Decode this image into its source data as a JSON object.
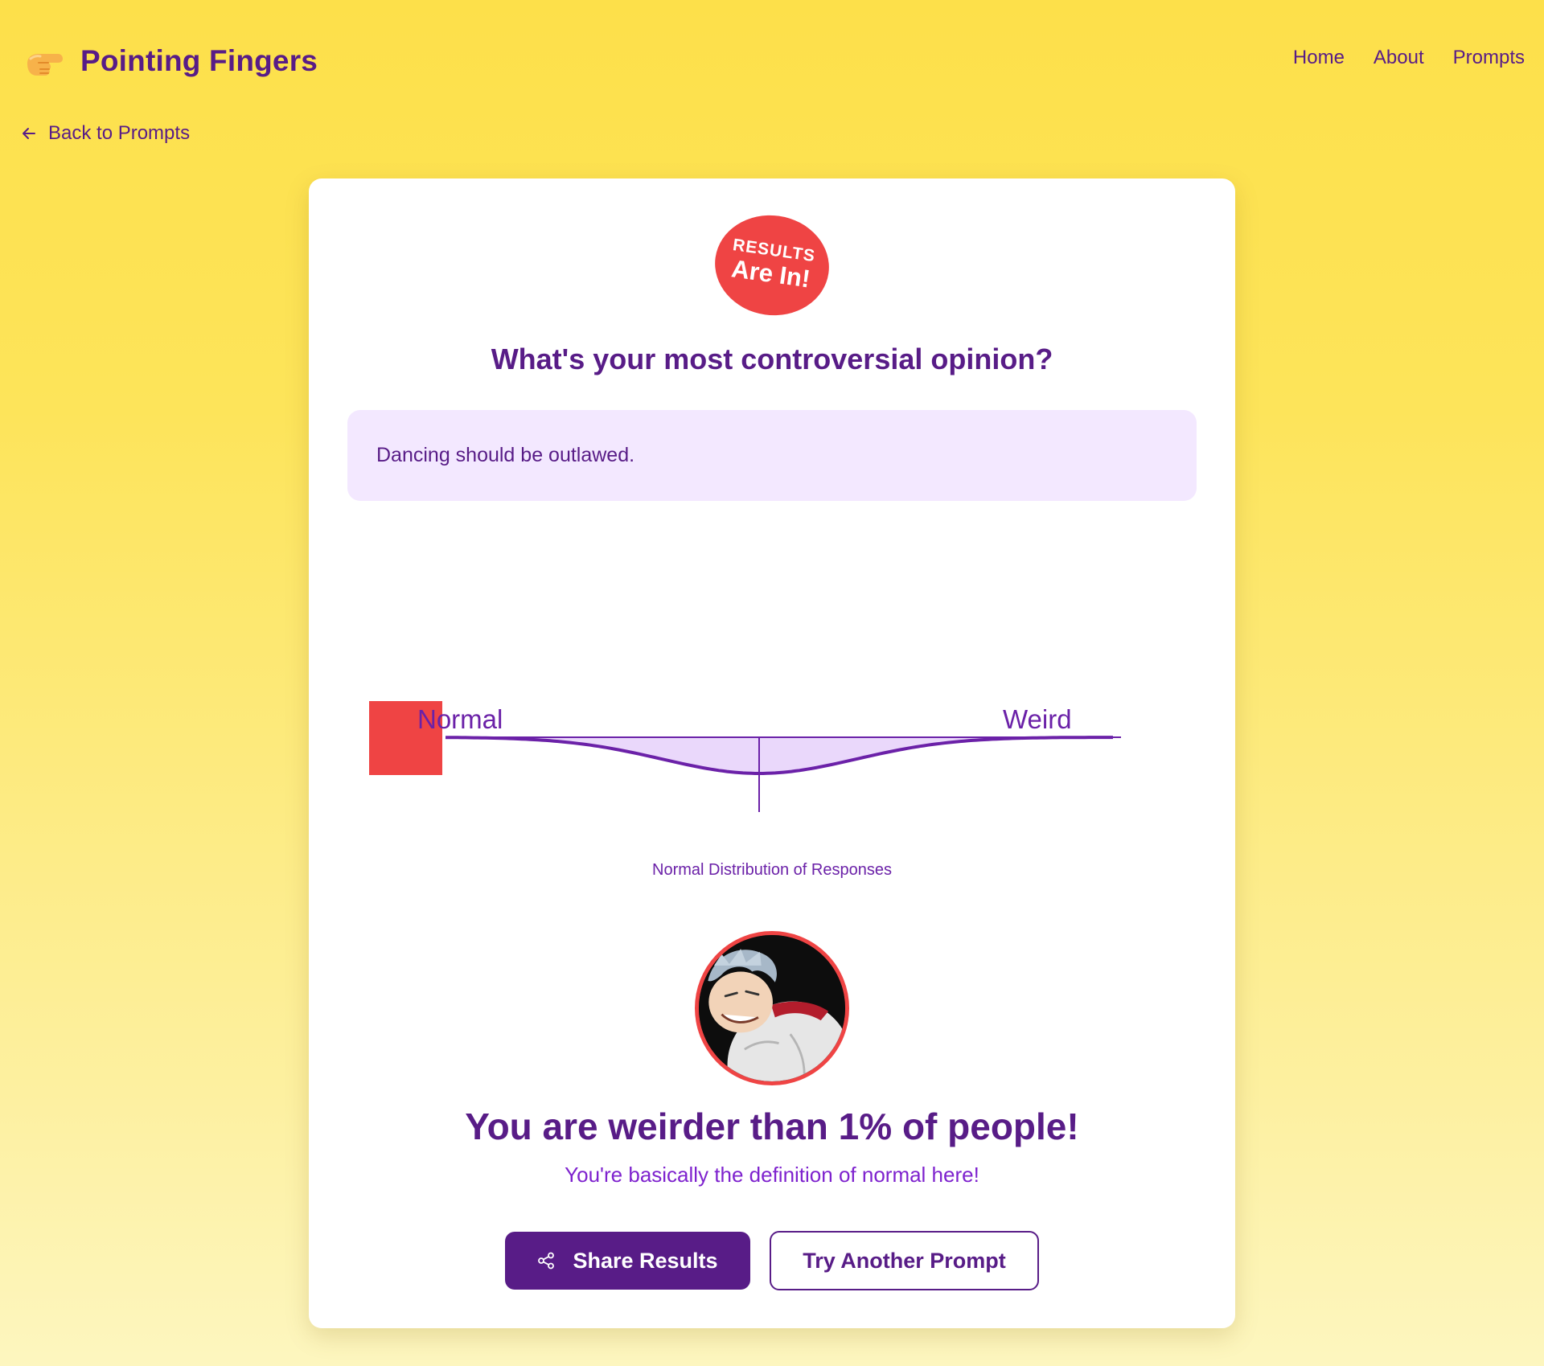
{
  "header": {
    "brand_name": "Pointing Fingers",
    "brand_icon": "pointing-finger-icon",
    "nav": [
      "Home",
      "About",
      "Prompts"
    ]
  },
  "back_link": "Back to Prompts",
  "badge": {
    "line1": "RESULTS",
    "line2": "Are In!"
  },
  "question": "What's your most controversial opinion?",
  "answer": "Dancing should be outlawed.",
  "chart_data": {
    "type": "line",
    "title": "",
    "xlabel": "",
    "ylabel": "",
    "labels": {
      "left": "Normal",
      "right": "Weird"
    },
    "caption": "Normal Distribution of Responses",
    "marker_percentile": 1,
    "colors": {
      "curve": "#6b21a8",
      "fill": "#ead8fb",
      "marker": "#ef4444"
    }
  },
  "result": {
    "title": "You are weirder than 1% of people!",
    "subtitle": "You're basically the definition of normal here!"
  },
  "buttons": {
    "share": "Share Results",
    "try_another": "Try Another Prompt"
  },
  "colors": {
    "primary": "#581c87",
    "accent": "#ef4444",
    "answer_bg": "#f3e8ff"
  }
}
